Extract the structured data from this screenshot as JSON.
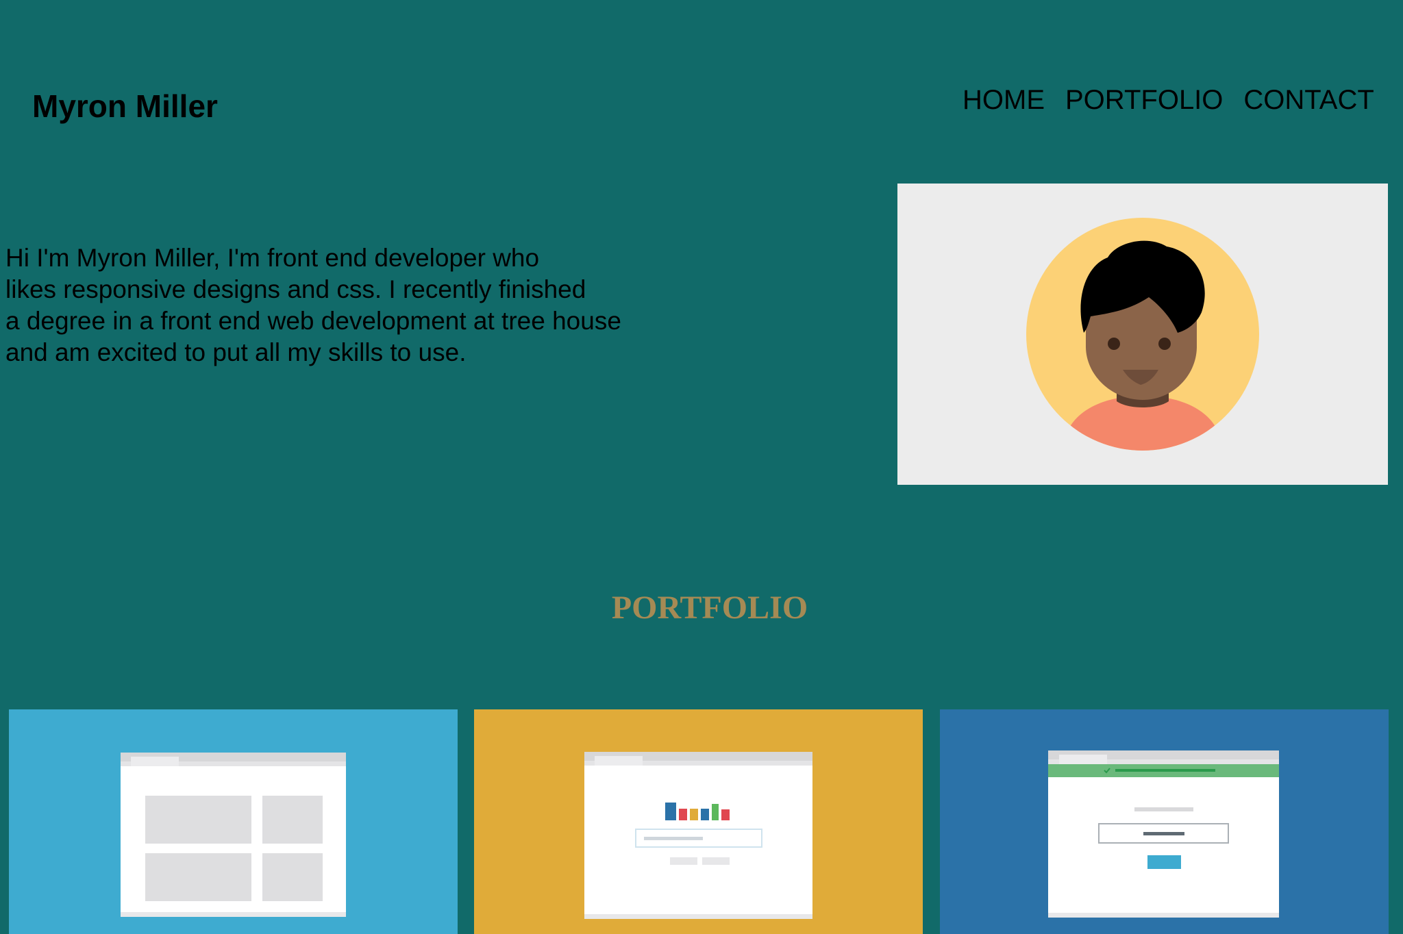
{
  "header": {
    "site_name": "Myron Miller",
    "nav": [
      {
        "label": "HOME"
      },
      {
        "label": "PORTFOLIO"
      },
      {
        "label": "CONTACT"
      }
    ]
  },
  "hero": {
    "bio_lines": [
      "Hi I'm Myron Miller, I'm front end developer who",
      "likes responsive designs and css. I recently finished",
      "a degree in a front end web development at tree house",
      "and am excited to put all my skills to use."
    ],
    "avatar_icon": "person-avatar-icon"
  },
  "portfolio": {
    "title": "PORTFOLIO",
    "items": [
      {
        "icon": "layout-grid-wireframe",
        "color": "#3eabd0"
      },
      {
        "icon": "signup-form-wireframe",
        "color": "#e0ab39"
      },
      {
        "icon": "login-success-wireframe",
        "color": "#2b72a8"
      }
    ]
  },
  "colors": {
    "background": "#116a69",
    "portfolio_title": "#a58a54",
    "avatar_panel": "#ececec"
  }
}
